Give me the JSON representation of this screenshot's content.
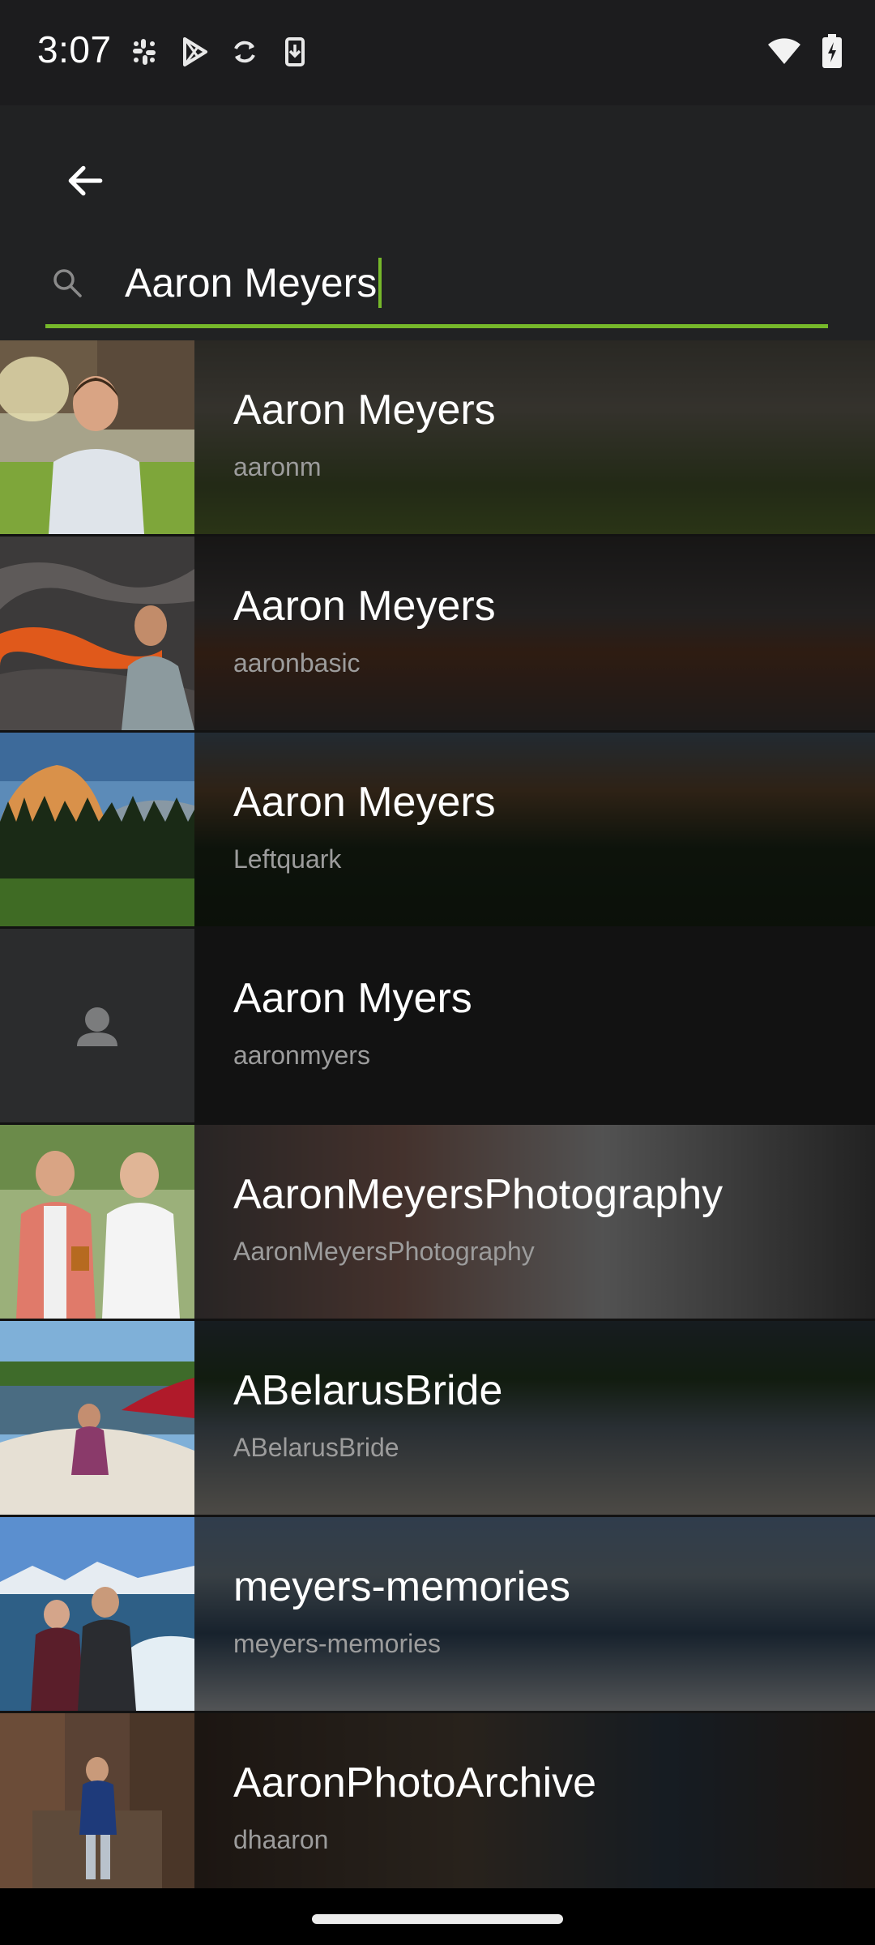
{
  "status_bar": {
    "time": "3:07",
    "left_icons": [
      "slack-icon",
      "play-store-icon",
      "sync-icon",
      "download-icon"
    ],
    "right_icons": [
      "wifi-icon",
      "battery-charging-icon"
    ]
  },
  "search": {
    "query": "Aaron Meyers",
    "accent_color": "#76b82a"
  },
  "results": [
    {
      "name": "Aaron Meyers",
      "username": "aaronm",
      "thumb": "portrait-outdoor"
    },
    {
      "name": "Aaron Meyers",
      "username": "aaronbasic",
      "thumb": "lava-field"
    },
    {
      "name": "Aaron Meyers",
      "username": "Leftquark",
      "thumb": "mountain-forest"
    },
    {
      "name": "Aaron Myers",
      "username": "aaronmyers",
      "thumb": "default-avatar"
    },
    {
      "name": "AaronMeyersPhotography",
      "username": "AaronMeyersPhotography",
      "thumb": "two-men"
    },
    {
      "name": "ABelarusBride",
      "username": "ABelarusBride",
      "thumb": "boat"
    },
    {
      "name": "meyers-memories",
      "username": "meyers-memories",
      "thumb": "boat-wake"
    },
    {
      "name": "AaronPhotoArchive",
      "username": "dhaaron",
      "thumb": "redwood"
    }
  ]
}
